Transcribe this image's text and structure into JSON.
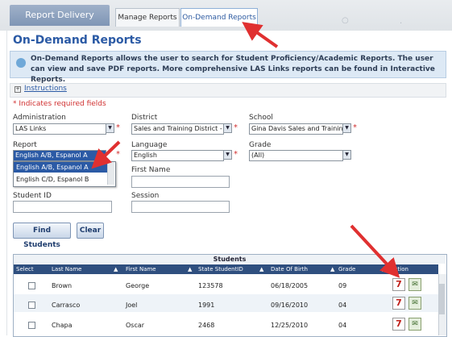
{
  "tabs": {
    "brand": "Report Delivery",
    "manage": "Manage Reports",
    "ondemand": "On-Demand Reports"
  },
  "page": {
    "title": "On-Demand Reports",
    "info": "On-Demand Reports allows the user to search for Student Proficiency/Academic Reports. The user can view and save PDF reports. More comprehensive LAS Links reports can be found in Interactive Reports.",
    "instructions": "Instructions",
    "required_note": "* Indicates required fields"
  },
  "form": {
    "administration_label": "Administration",
    "administration_value": "LAS Links",
    "district_label": "District",
    "district_value": "Sales and Training District -",
    "school_label": "School",
    "school_value": "Gina Davis Sales and Trainin",
    "report_label": "Report",
    "report_value": "English A/B, Espanol A",
    "report_options": [
      "English A/B, Espanol A",
      "English C/D, Espanol B"
    ],
    "language_label": "Language",
    "language_value": "English",
    "grade_label": "Grade",
    "grade_value": "(All)",
    "firstname_label": "First Name",
    "studentid_label": "Student ID",
    "session_label": "Session",
    "find_button": "Find Students",
    "clear_button": "Clear"
  },
  "table": {
    "caption": "Students",
    "headers": [
      "Select",
      "Last Name",
      "First Name",
      "State StudentID",
      "Date Of Birth",
      "Grade",
      "Action"
    ],
    "rows": [
      {
        "last": "Brown",
        "first": "George",
        "id": "123578",
        "dob": "06/18/2005",
        "grade": "09"
      },
      {
        "last": "Carrasco",
        "first": "Joel",
        "id": "1991",
        "dob": "09/16/2010",
        "grade": "04"
      },
      {
        "last": "Chapa",
        "first": "Oscar",
        "id": "2468",
        "dob": "12/25/2010",
        "grade": "04"
      }
    ]
  },
  "icons": {
    "pdf": "pdf-report-icon",
    "send": "send-report-icon",
    "info": "info-icon"
  },
  "colors": {
    "accent": "#2b5aa5",
    "header": "#2f4f7f",
    "required": "#d03030",
    "annotation": "#e03030"
  }
}
